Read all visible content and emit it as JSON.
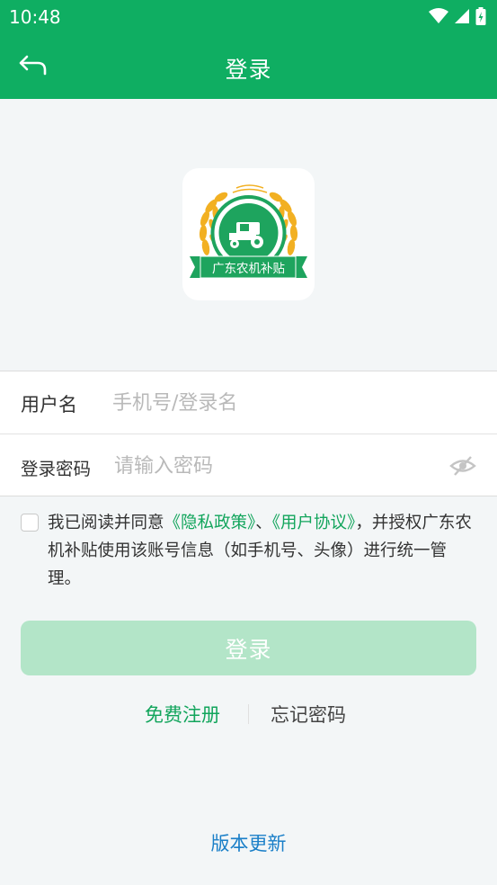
{
  "status_bar": {
    "time": "10:48"
  },
  "app_bar": {
    "title": "登录",
    "back_icon": "back-arrow-icon"
  },
  "logo": {
    "banner_text": "广东农机补贴",
    "icon": "tractor-wheat-logo"
  },
  "form": {
    "username_label": "用户名",
    "username_placeholder": "手机号/登录名",
    "password_label": "登录密码",
    "password_placeholder": "请输入密码",
    "visibility_icon": "eye-hidden-icon"
  },
  "agreement": {
    "prefix": "我已阅读并同意",
    "privacy_link": "《隐私政策》",
    "separator": "、",
    "user_link": "《用户协议》",
    "suffix": "，并授权广东农机补贴使用该账号信息（如手机号、头像）进行统一管理。"
  },
  "login_button": "登录",
  "links": {
    "register": "免费注册",
    "forgot": "忘记密码"
  },
  "version_update": "版本更新",
  "colors": {
    "primary": "#0fae62",
    "button_disabled": "#b3e5c8",
    "link_green": "#12a55c",
    "link_blue": "#1a7fc8"
  }
}
